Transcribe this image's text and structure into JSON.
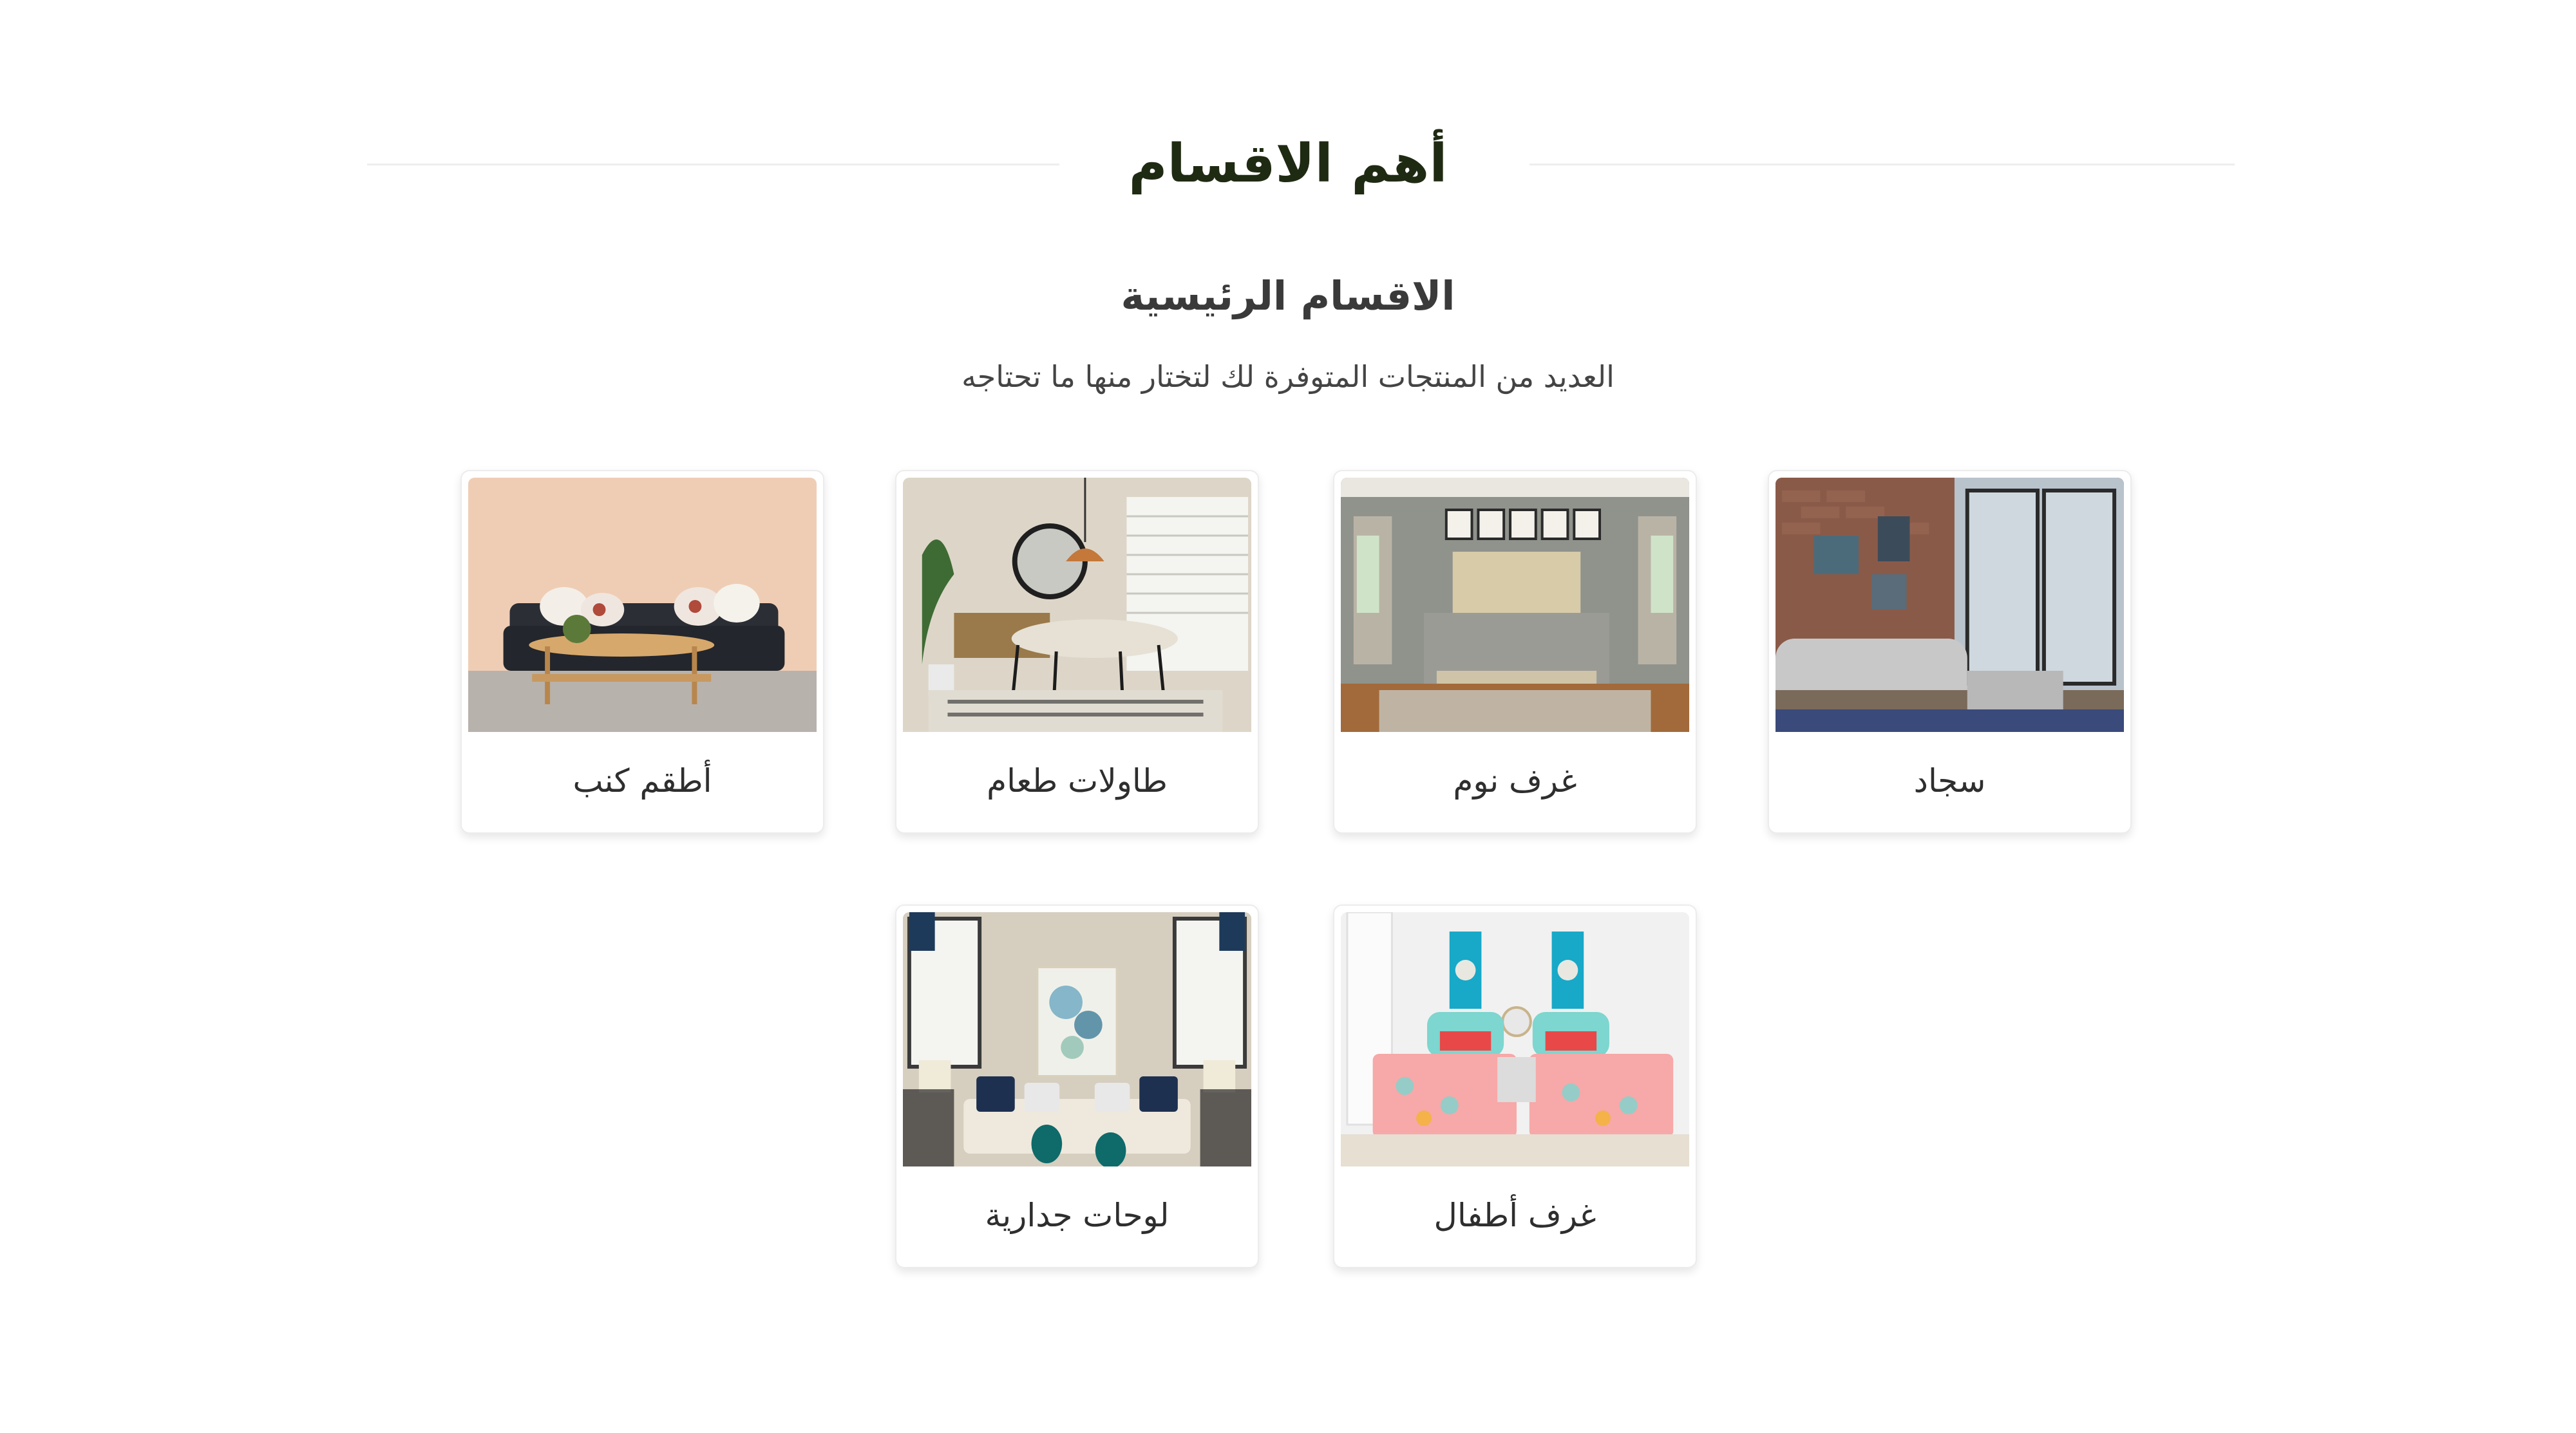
{
  "section": {
    "title": "أهم الاقسام",
    "subtitle": "الاقسام الرئيسية",
    "description": "العديد من المنتجات المتوفرة لك لتختار منها ما تحتاجه"
  },
  "categories": [
    {
      "label": "سجاد",
      "image": "living-room-brick-wall-photo"
    },
    {
      "label": "غرف نوم",
      "image": "bedroom-photo"
    },
    {
      "label": "طاولات طعام",
      "image": "dining-room-photo"
    },
    {
      "label": "أطقم كنب",
      "image": "sofa-set-photo"
    },
    {
      "label": "غرف أطفال",
      "image": "kids-room-photo"
    },
    {
      "label": "لوحات جدارية",
      "image": "wall-art-photo"
    }
  ],
  "colors": {
    "title": "#1f2a12",
    "text": "#2e2e2e",
    "rule": "#eeeeee"
  }
}
